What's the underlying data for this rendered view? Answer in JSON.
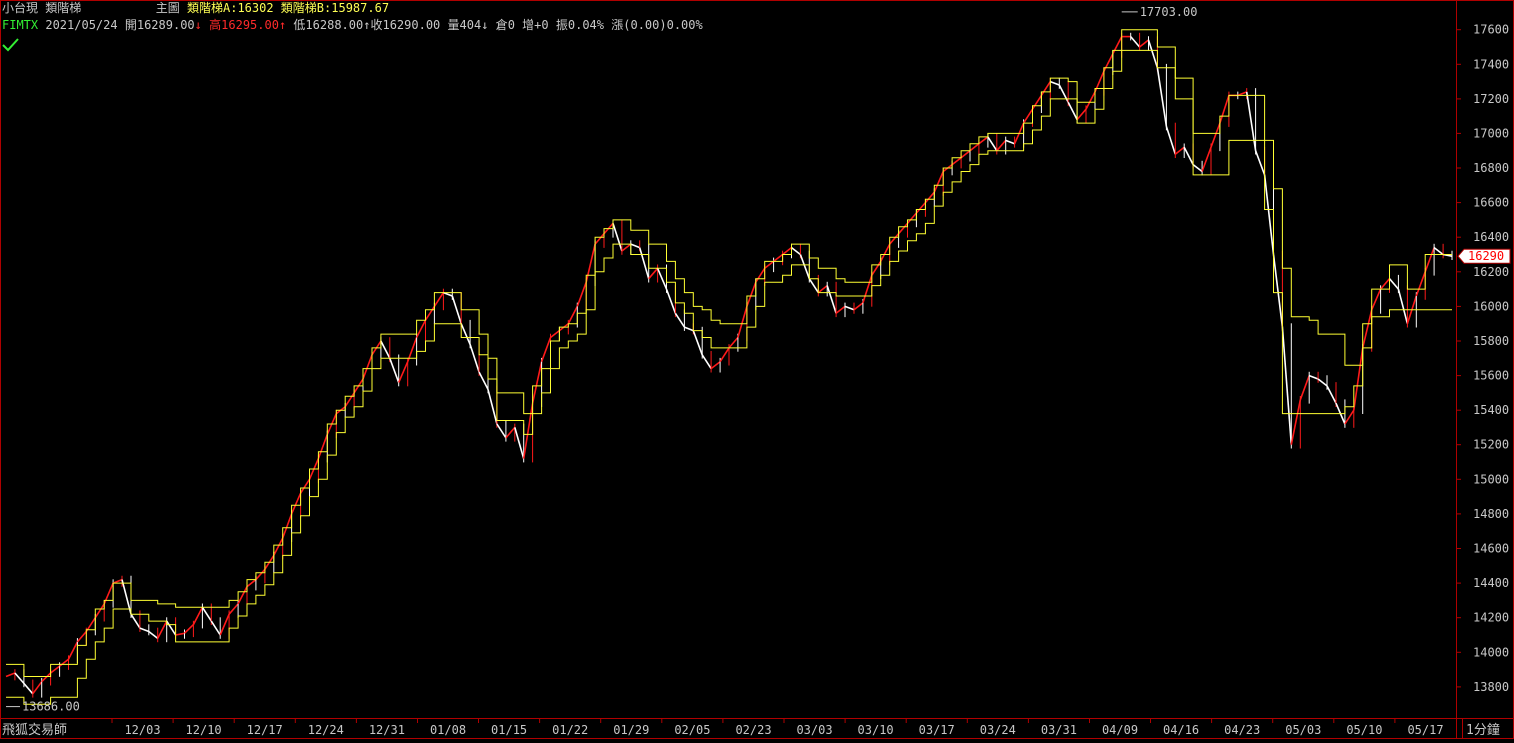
{
  "header": {
    "product": "小台現",
    "indicator": "類階梯",
    "main_label": "主圖",
    "ind_a_label": "類階梯A:",
    "ind_a_value": "16302",
    "ind_b_label": "類階梯B:",
    "ind_b_value": "15987.67"
  },
  "quote": {
    "symbol": "FIMTX",
    "date": "2021/05/24",
    "open_label": "開",
    "open": "16289.00",
    "high_label": "高",
    "high": "16295.00",
    "low_label": "低",
    "low": "16288.00",
    "close_label": "收",
    "close": "16290.00",
    "volume_label": "量",
    "volume": "404",
    "oi_label": "倉",
    "oi": "0",
    "oi_change_label": "增",
    "oi_change": "+0",
    "amplitude_label": "振",
    "amplitude": "0.04%",
    "change_label": "漲",
    "change": "(0.00)0.00%"
  },
  "footer": {
    "brand": "飛狐交易師",
    "period": "1分鐘"
  },
  "colors": {
    "background": "#000000",
    "axis": "#b00000",
    "price_up": "#ff1a1a",
    "price_down": "#ffffff",
    "ladder": "#ffff33",
    "text": "#c8c8c8",
    "last_price_box": "#ffffff",
    "last_price_text": "#ff0000"
  },
  "chart_data": {
    "type": "line",
    "ylim": [
      13620,
      17760
    ],
    "y_ticks": [
      13800,
      14000,
      14200,
      14400,
      14600,
      14800,
      15000,
      15200,
      15400,
      15600,
      15800,
      16000,
      16200,
      16400,
      16600,
      16800,
      17000,
      17200,
      17400,
      17600
    ],
    "x_ticks": [
      "12/03",
      "12/10",
      "12/17",
      "12/24",
      "12/31",
      "01/08",
      "01/15",
      "01/22",
      "01/29",
      "02/05",
      "02/23",
      "03/03",
      "03/10",
      "03/17",
      "03/24",
      "03/31",
      "04/09",
      "04/16",
      "04/23",
      "05/03",
      "05/10",
      "05/17"
    ],
    "max_label": "17703.00",
    "min_label": "13686.00",
    "last_price": "16290",
    "price": [
      13860,
      13880,
      13820,
      13760,
      13830,
      13880,
      13920,
      13960,
      14060,
      14120,
      14200,
      14280,
      14400,
      14420,
      14220,
      14140,
      14120,
      14080,
      14180,
      14100,
      14110,
      14160,
      14260,
      14180,
      14100,
      14220,
      14280,
      14380,
      14420,
      14480,
      14560,
      14660,
      14800,
      14920,
      15000,
      15120,
      15260,
      15380,
      15420,
      15500,
      15580,
      15720,
      15800,
      15700,
      15560,
      15680,
      15820,
      15920,
      16000,
      16080,
      16060,
      15900,
      15780,
      15620,
      15520,
      15320,
      15240,
      15300,
      15120,
      15440,
      15680,
      15820,
      15860,
      15900,
      16000,
      16140,
      16360,
      16420,
      16480,
      16320,
      16360,
      16340,
      16160,
      16220,
      16100,
      15960,
      15880,
      15860,
      15720,
      15640,
      15680,
      15760,
      15820,
      16000,
      16140,
      16220,
      16260,
      16300,
      16340,
      16300,
      16160,
      16080,
      16120,
      15960,
      16000,
      15980,
      16020,
      16180,
      16260,
      16360,
      16420,
      16480,
      16540,
      16600,
      16660,
      16780,
      16820,
      16860,
      16900,
      16940,
      16980,
      16900,
      16960,
      16940,
      17060,
      17140,
      17220,
      17300,
      17280,
      17180,
      17080,
      17140,
      17240,
      17360,
      17460,
      17560,
      17560,
      17500,
      17540,
      17380,
      17040,
      16880,
      16920,
      16820,
      16780,
      16920,
      17060,
      17220,
      17220,
      17240,
      16900,
      16760,
      16300,
      15880,
      15200,
      15460,
      15600,
      15580,
      15540,
      15440,
      15320,
      15400,
      15760,
      15980,
      16100,
      16160,
      16100,
      15900,
      16060,
      16200,
      16340,
      16300,
      16290
    ],
    "series": [
      {
        "values": [
          13930,
          13930,
          13860,
          13860,
          13860,
          13930,
          13930,
          13930,
          14040,
          14130,
          14250,
          14300,
          14400,
          14400,
          14300,
          14300,
          14300,
          14280,
          14280,
          14260,
          14260,
          14260,
          14260,
          14260,
          14260,
          14300,
          14350,
          14420,
          14460,
          14520,
          14620,
          14720,
          14850,
          14950,
          15060,
          15160,
          15320,
          15400,
          15480,
          15540,
          15640,
          15760,
          15840,
          15840,
          15840,
          15840,
          15920,
          15980,
          16080,
          16080,
          16080,
          15980,
          15980,
          15840,
          15700,
          15500,
          15500,
          15500,
          15380,
          15540,
          15640,
          15800,
          15880,
          15900,
          15960,
          16180,
          16400,
          16450,
          16500,
          16500,
          16440,
          16440,
          16360,
          16360,
          16260,
          16160,
          16080,
          16000,
          15980,
          15920,
          15900,
          15900,
          15900,
          16060,
          16160,
          16260,
          16260,
          16300,
          16360,
          16360,
          16280,
          16220,
          16220,
          16160,
          16140,
          16140,
          16140,
          16240,
          16300,
          16400,
          16460,
          16500,
          16560,
          16620,
          16700,
          16800,
          16860,
          16900,
          16940,
          16980,
          17000,
          17000,
          17000,
          17000,
          17060,
          17160,
          17240,
          17320,
          17320,
          17300,
          17180,
          17180,
          17260,
          17380,
          17480,
          17600,
          17600,
          17600,
          17600,
          17500,
          17500,
          17320,
          17320,
          17000,
          17000,
          17000,
          17100,
          17220,
          17220,
          17220,
          17220,
          16960,
          16680,
          16220,
          15940,
          15940,
          15920,
          15840,
          15840,
          15840,
          15660,
          15660,
          15900,
          16100,
          16100,
          16240,
          16240,
          16100,
          16100,
          16300,
          16300,
          16300,
          16300
        ]
      },
      {
        "values": [
          13740,
          13740,
          13700,
          13700,
          13700,
          13740,
          13740,
          13740,
          13850,
          13960,
          14060,
          14140,
          14250,
          14250,
          14220,
          14220,
          14180,
          14180,
          14160,
          14060,
          14060,
          14060,
          14060,
          14060,
          14060,
          14140,
          14210,
          14280,
          14330,
          14390,
          14460,
          14560,
          14690,
          14790,
          14900,
          15000,
          15140,
          15270,
          15360,
          15420,
          15510,
          15640,
          15700,
          15700,
          15700,
          15700,
          15740,
          15800,
          15900,
          15900,
          15900,
          15820,
          15820,
          15720,
          15580,
          15340,
          15340,
          15340,
          15260,
          15380,
          15500,
          15640,
          15760,
          15800,
          15840,
          15980,
          16200,
          16280,
          16360,
          16360,
          16300,
          16300,
          16220,
          16220,
          16140,
          16020,
          15960,
          15860,
          15820,
          15760,
          15760,
          15760,
          15760,
          15880,
          16000,
          16140,
          16140,
          16180,
          16240,
          16240,
          16160,
          16080,
          16080,
          16060,
          16060,
          16060,
          16060,
          16120,
          16180,
          16260,
          16320,
          16380,
          16420,
          16480,
          16580,
          16660,
          16720,
          16780,
          16820,
          16880,
          16900,
          16900,
          16900,
          16900,
          16940,
          17020,
          17100,
          17200,
          17200,
          17200,
          17060,
          17060,
          17140,
          17260,
          17360,
          17480,
          17480,
          17480,
          17480,
          17380,
          17380,
          17200,
          17200,
          16760,
          16760,
          16760,
          16760,
          16960,
          16960,
          16960,
          16960,
          16560,
          16080,
          15380,
          15380,
          15380,
          15380,
          15380,
          15380,
          15380,
          15420,
          15540,
          15760,
          15940,
          15940,
          15980,
          15980,
          15980,
          15980,
          15980,
          15980,
          15980,
          15980
        ]
      }
    ]
  }
}
